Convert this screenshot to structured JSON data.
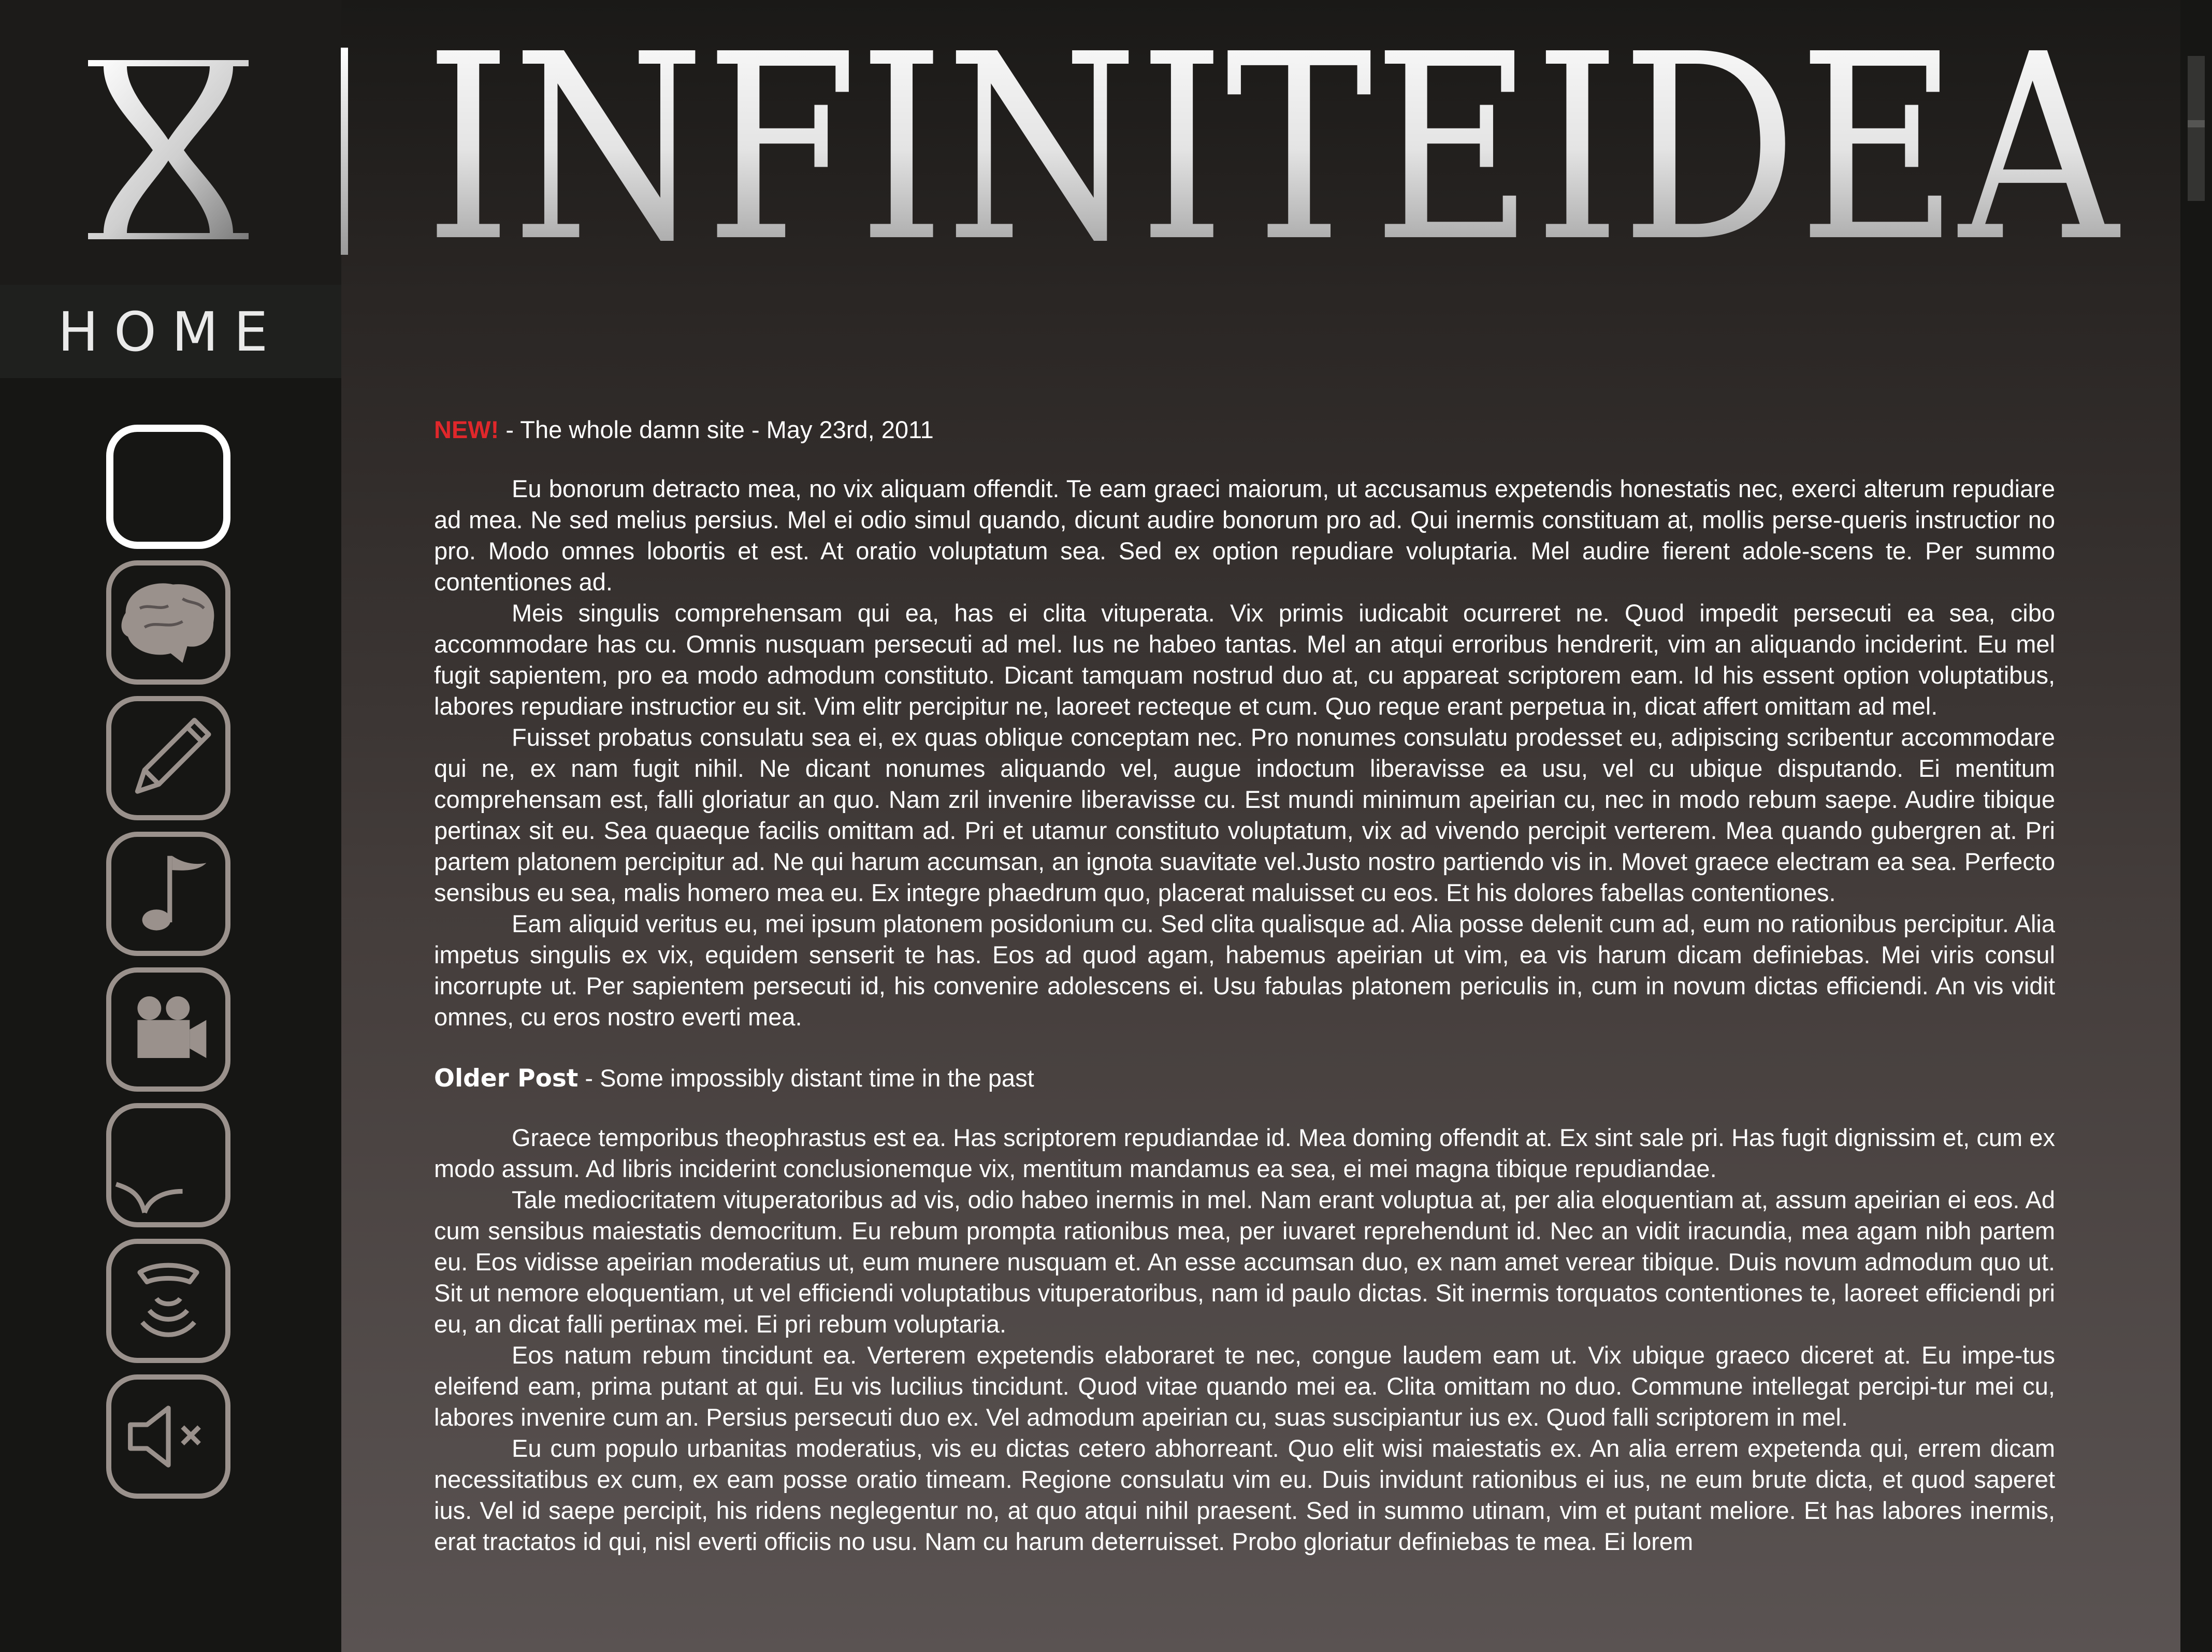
{
  "site": {
    "brand": "INFINITEIDEA",
    "logo_icon": "infinity-eight-icon"
  },
  "nav": {
    "current_label": "HOME",
    "items": [
      {
        "name": "home",
        "icon": "blank-square-icon"
      },
      {
        "name": "brain",
        "icon": "brain-icon"
      },
      {
        "name": "writing",
        "icon": "pencil-icon"
      },
      {
        "name": "music",
        "icon": "music-note-icon"
      },
      {
        "name": "video",
        "icon": "movie-camera-icon"
      },
      {
        "name": "comments",
        "icon": "speech-bubble-icon"
      },
      {
        "name": "contact",
        "icon": "telephone-icon"
      },
      {
        "name": "sound",
        "icon": "speaker-mute-icon"
      }
    ]
  },
  "posts": [
    {
      "tag": "NEW!",
      "title": " - The whole damn site - May 23rd, 2011",
      "paragraphs": [
        "Eu bonorum detracto mea, no vix aliquam offendit. Te eam graeci maiorum, ut accusamus expetendis honestatis nec, exerci alterum repudiare ad mea. Ne sed melius persius. Mel ei odio simul quando, dicunt audire bonorum pro ad. Qui inermis constituam at, mollis perse-queris instructior no pro. Modo omnes lobortis et est. At oratio voluptatum sea. Sed ex option repudiare voluptaria. Mel audire fierent adole-scens te. Per summo contentiones ad.",
        "Meis singulis comprehensam qui ea, has ei clita vituperata. Vix primis iudicabit ocurreret ne. Quod impedit persecuti ea sea, cibo accommodare has cu. Omnis nusquam persecuti ad mel. Ius ne habeo tantas. Mel an atqui erroribus hendrerit, vim an aliquando inciderint. Eu mel fugit sapientem, pro ea modo admodum constituto. Dicant tamquam nostrud duo at, cu appareat scriptorem eam. Id his essent option voluptatibus, labores repudiare instructior eu sit. Vim elitr percipitur ne, laoreet recteque et cum. Quo reque erant perpetua in, dicat affert omittam ad mel.",
        "Fuisset probatus consulatu sea ei, ex quas oblique conceptam nec. Pro nonumes consulatu prodesset eu, adipiscing scribentur accommodare qui ne, ex nam fugit nihil. Ne dicant nonumes aliquando vel, augue indoctum liberavisse ea usu, vel cu ubique disputando. Ei mentitum comprehensam est, falli gloriatur an quo. Nam zril invenire liberavisse cu. Est mundi minimum apeirian cu, nec in modo rebum saepe. Audire tibique pertinax sit eu. Sea quaeque facilis omittam ad. Pri et utamur constituto voluptatum, vix ad vivendo percipit verterem. Mea quando gubergren at. Pri partem platonem percipitur ad. Ne qui harum accumsan, an ignota suavitate vel.Justo nostro partiendo vis in. Movet graece electram ea sea. Perfecto sensibus eu sea, malis homero mea eu. Ex integre phaedrum quo, placerat maluisset cu eos. Et his dolores fabellas contentiones.",
        "Eam aliquid veritus eu, mei ipsum platonem posidonium cu. Sed clita qualisque ad. Alia posse delenit cum ad, eum no rationibus percipitur. Alia impetus singulis ex vix, equidem senserit te has. Eos ad quod agam, habemus apeirian ut vim, ea vis harum dicam definiebas. Mei viris consul incorrupte ut. Per sapientem persecuti id, his convenire adolescens ei. Usu fabulas platonem periculis in, cum in novum dictas efficiendi. An vis vidit omnes, cu eros nostro everti mea."
      ]
    },
    {
      "tag": "Older Post",
      "title": " - Some impossibly distant time in the past",
      "paragraphs": [
        "Graece temporibus theophrastus est ea. Has scriptorem repudiandae id. Mea doming offendit at. Ex sint sale pri. Has fugit dignissim et, cum ex modo assum. Ad libris inciderint conclusionemque vix, mentitum mandamus ea sea, ei mei magna tibique repudiandae.",
        "Tale mediocritatem vituperatoribus ad vis, odio habeo inermis in mel. Nam erant voluptua at, per alia eloquentiam at, assum apeirian ei eos. Ad cum sensibus maiestatis democritum. Eu rebum prompta rationibus mea, per iuvaret reprehendunt id. Nec an vidit iracundia, mea agam nibh partem eu. Eos vidisse apeirian moderatius ut, eum munere nusquam et. An esse accumsan duo, ex nam amet verear tibique. Duis novum admodum quo ut. Sit ut nemore eloquentiam, ut vel efficiendi voluptatibus vituperatoribus, nam id paulo dictas. Sit inermis torquatos contentiones te, laoreet efficiendi pri eu, an dicat falli pertinax mei. Ei pri rebum voluptaria.",
        "Eos natum rebum tincidunt ea. Verterem expetendis elaboraret te nec, congue laudem eam ut. Vix ubique graeco diceret at. Eu impe-tus eleifend eam, prima putant at qui. Eu vis lucilius tincidunt. Quod vitae quando mei ea. Clita omittam no duo. Commune intellegat percipi-tur mei cu, labores invenire cum an. Persius persecuti duo ex. Vel admodum apeirian cu, suas suscipiantur ius ex. Quod falli scriptorem in mel.",
        "Eu cum populo urbanitas moderatius, vis eu dictas cetero abhorreant. Quo elit wisi maiestatis ex. An alia errem expetenda qui, errem dicam necessitatibus ex cum, ex eam posse oratio timeam. Regione consulatu vim eu. Duis invidunt rationibus ei ius, ne eum brute dicta, et quod saperet ius. Vel id saepe percipit, his ridens neglegentur no, at quo atqui nihil praesent. Sed in summo utinam, vim et putant meliore. Et has labores inermis, erat tractatos id qui, nisl everti officiis no usu. Nam cu harum deterruisset. Probo gloriatur definiebas te mea. Ei lorem"
      ]
    }
  ]
}
